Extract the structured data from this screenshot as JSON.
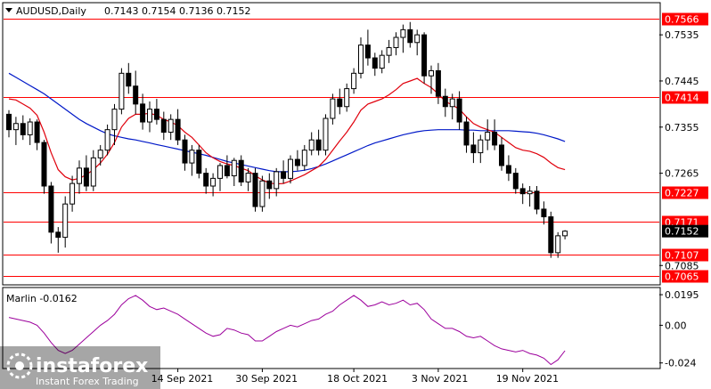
{
  "header": {
    "symbol": "AUDUSD,Daily",
    "ohlc": "0.7143 0.7154 0.7136 0.7152"
  },
  "indicator": {
    "label": "Marlin -0.0162"
  },
  "watermark": {
    "brand": "instaforex",
    "tagline": "Instant Forex Trading"
  },
  "colors": {
    "level_line": "#ff0000",
    "ma_fast": "#e0000c",
    "ma_slow": "#0018c8",
    "oscillator": "#9c009c",
    "candle": "#000000",
    "current_price_bg": "#000000"
  },
  "chart_data": {
    "type": "candlestick",
    "symbol": "AUDUSD",
    "timeframe": "Daily",
    "price_axis": {
      "ticks": [
        "0.7535",
        "0.7445",
        "0.7355",
        "0.7265",
        "0.7085"
      ],
      "range": [
        0.7049,
        0.7596
      ]
    },
    "levels": [
      {
        "value": 0.7566,
        "label": "0.7566"
      },
      {
        "value": 0.7414,
        "label": "0.7414"
      },
      {
        "value": 0.7227,
        "label": "0.7227"
      },
      {
        "value": 0.7171,
        "label": "0.7171"
      },
      {
        "value": 0.7107,
        "label": "0.7107"
      },
      {
        "value": 0.7065,
        "label": "0.7065"
      }
    ],
    "current_price": {
      "value": 0.7152,
      "label": "0.7152"
    },
    "date_labels": [
      {
        "label": "14 Sep 2021",
        "index": 24
      },
      {
        "label": "30 Sep 2021",
        "index": 36
      },
      {
        "label": "18 Oct 2021",
        "index": 49
      },
      {
        "label": "3 Nov 2021",
        "index": 61
      },
      {
        "label": "19 Nov 2021",
        "index": 73
      }
    ],
    "candles": [
      [
        0.738,
        0.7388,
        0.7335,
        0.735
      ],
      [
        0.735,
        0.7375,
        0.732,
        0.7362
      ],
      [
        0.7362,
        0.7378,
        0.733,
        0.734
      ],
      [
        0.734,
        0.7372,
        0.732,
        0.7365
      ],
      [
        0.7365,
        0.737,
        0.731,
        0.7325
      ],
      [
        0.7325,
        0.733,
        0.7225,
        0.724
      ],
      [
        0.724,
        0.7248,
        0.7128,
        0.715
      ],
      [
        0.715,
        0.716,
        0.711,
        0.714
      ],
      [
        0.714,
        0.722,
        0.712,
        0.7205
      ],
      [
        0.7205,
        0.726,
        0.719,
        0.7245
      ],
      [
        0.7245,
        0.729,
        0.7225,
        0.7275
      ],
      [
        0.7275,
        0.73,
        0.723,
        0.724
      ],
      [
        0.724,
        0.731,
        0.723,
        0.7295
      ],
      [
        0.7295,
        0.732,
        0.728,
        0.731
      ],
      [
        0.731,
        0.736,
        0.73,
        0.735
      ],
      [
        0.735,
        0.74,
        0.732,
        0.739
      ],
      [
        0.739,
        0.747,
        0.738,
        0.746
      ],
      [
        0.746,
        0.748,
        0.742,
        0.7435
      ],
      [
        0.7435,
        0.7465,
        0.738,
        0.74
      ],
      [
        0.74,
        0.742,
        0.735,
        0.7365
      ],
      [
        0.7365,
        0.7405,
        0.7345,
        0.739
      ],
      [
        0.739,
        0.741,
        0.736,
        0.737
      ],
      [
        0.737,
        0.7385,
        0.733,
        0.7345
      ],
      [
        0.7345,
        0.738,
        0.733,
        0.737
      ],
      [
        0.737,
        0.739,
        0.732,
        0.733
      ],
      [
        0.733,
        0.734,
        0.727,
        0.7285
      ],
      [
        0.7285,
        0.732,
        0.726,
        0.731
      ],
      [
        0.731,
        0.732,
        0.7255,
        0.7265
      ],
      [
        0.7265,
        0.7275,
        0.7225,
        0.724
      ],
      [
        0.724,
        0.7265,
        0.722,
        0.7255
      ],
      [
        0.7255,
        0.7285,
        0.723,
        0.728
      ],
      [
        0.728,
        0.73,
        0.7255,
        0.726
      ],
      [
        0.726,
        0.7295,
        0.724,
        0.729
      ],
      [
        0.729,
        0.73,
        0.724,
        0.7248
      ],
      [
        0.7248,
        0.7275,
        0.723,
        0.7265
      ],
      [
        0.7265,
        0.7275,
        0.719,
        0.72
      ],
      [
        0.72,
        0.726,
        0.719,
        0.725
      ],
      [
        0.725,
        0.7265,
        0.7215,
        0.7235
      ],
      [
        0.7235,
        0.7275,
        0.722,
        0.7268
      ],
      [
        0.7268,
        0.729,
        0.7245,
        0.7255
      ],
      [
        0.7255,
        0.73,
        0.7245,
        0.7292
      ],
      [
        0.7292,
        0.731,
        0.727,
        0.728
      ],
      [
        0.728,
        0.732,
        0.727,
        0.731
      ],
      [
        0.731,
        0.7345,
        0.73,
        0.733
      ],
      [
        0.733,
        0.735,
        0.73,
        0.731
      ],
      [
        0.731,
        0.738,
        0.73,
        0.7372
      ],
      [
        0.7372,
        0.742,
        0.736,
        0.741
      ],
      [
        0.741,
        0.743,
        0.738,
        0.7395
      ],
      [
        0.7395,
        0.744,
        0.7385,
        0.743
      ],
      [
        0.743,
        0.747,
        0.742,
        0.746
      ],
      [
        0.746,
        0.753,
        0.745,
        0.7515
      ],
      [
        0.7515,
        0.7545,
        0.7475,
        0.749
      ],
      [
        0.749,
        0.75,
        0.7455,
        0.747
      ],
      [
        0.747,
        0.7505,
        0.746,
        0.7495
      ],
      [
        0.7495,
        0.7525,
        0.748,
        0.751
      ],
      [
        0.751,
        0.754,
        0.7495,
        0.753
      ],
      [
        0.753,
        0.7555,
        0.75,
        0.7545
      ],
      [
        0.7545,
        0.756,
        0.751,
        0.752
      ],
      [
        0.752,
        0.7545,
        0.7495,
        0.7535
      ],
      [
        0.7535,
        0.754,
        0.744,
        0.7455
      ],
      [
        0.7455,
        0.7475,
        0.742,
        0.7465
      ],
      [
        0.7465,
        0.748,
        0.74,
        0.7415
      ],
      [
        0.7415,
        0.743,
        0.7375,
        0.7395
      ],
      [
        0.7395,
        0.742,
        0.737,
        0.741
      ],
      [
        0.741,
        0.7425,
        0.735,
        0.7365
      ],
      [
        0.7365,
        0.7375,
        0.7305,
        0.732
      ],
      [
        0.732,
        0.7345,
        0.7285,
        0.7305
      ],
      [
        0.7305,
        0.734,
        0.7285,
        0.733
      ],
      [
        0.733,
        0.737,
        0.731,
        0.7345
      ],
      [
        0.7345,
        0.737,
        0.731,
        0.732
      ],
      [
        0.732,
        0.7335,
        0.727,
        0.728
      ],
      [
        0.728,
        0.73,
        0.725,
        0.7265
      ],
      [
        0.7265,
        0.7275,
        0.7225,
        0.7235
      ],
      [
        0.7235,
        0.7245,
        0.7205,
        0.7225
      ],
      [
        0.7225,
        0.724,
        0.72,
        0.723
      ],
      [
        0.723,
        0.724,
        0.7185,
        0.7195
      ],
      [
        0.7195,
        0.721,
        0.7165,
        0.718
      ],
      [
        0.718,
        0.719,
        0.71,
        0.711
      ],
      [
        0.711,
        0.715,
        0.71,
        0.7143
      ],
      [
        0.7143,
        0.7154,
        0.7136,
        0.7152
      ]
    ],
    "ma_fast": [
      0.741,
      0.7408,
      0.74,
      0.7392,
      0.7378,
      0.7345,
      0.7305,
      0.7272,
      0.7258,
      0.7252,
      0.7255,
      0.7262,
      0.7272,
      0.7285,
      0.7302,
      0.7325,
      0.7355,
      0.7372,
      0.738,
      0.738,
      0.7382,
      0.7378,
      0.737,
      0.7365,
      0.7358,
      0.7345,
      0.7335,
      0.732,
      0.7305,
      0.7295,
      0.7288,
      0.7283,
      0.728,
      0.7275,
      0.727,
      0.726,
      0.7252,
      0.7246,
      0.7244,
      0.7245,
      0.725,
      0.7256,
      0.7262,
      0.727,
      0.7278,
      0.7292,
      0.731,
      0.7328,
      0.7345,
      0.7365,
      0.7388,
      0.74,
      0.7405,
      0.741,
      0.7418,
      0.7428,
      0.744,
      0.7445,
      0.745,
      0.744,
      0.7432,
      0.742,
      0.7405,
      0.7398,
      0.739,
      0.7375,
      0.7362,
      0.7355,
      0.735,
      0.7345,
      0.7335,
      0.7325,
      0.7315,
      0.731,
      0.7308,
      0.7303,
      0.7296,
      0.7285,
      0.7276,
      0.7272
    ],
    "ma_slow": [
      0.746,
      0.7452,
      0.7444,
      0.7436,
      0.7428,
      0.742,
      0.741,
      0.74,
      0.739,
      0.738,
      0.737,
      0.7362,
      0.7355,
      0.7348,
      0.7342,
      0.7338,
      0.7335,
      0.7332,
      0.733,
      0.7327,
      0.7324,
      0.7321,
      0.7318,
      0.7315,
      0.7312,
      0.7309,
      0.7306,
      0.7303,
      0.73,
      0.7296,
      0.7292,
      0.7288,
      0.7285,
      0.7282,
      0.7279,
      0.7276,
      0.7273,
      0.727,
      0.7268,
      0.7268,
      0.7268,
      0.7269,
      0.7271,
      0.7274,
      0.7278,
      0.7283,
      0.7289,
      0.7295,
      0.7301,
      0.7307,
      0.7313,
      0.7319,
      0.7324,
      0.7328,
      0.7332,
      0.7336,
      0.734,
      0.7343,
      0.7346,
      0.7348,
      0.7349,
      0.735,
      0.735,
      0.735,
      0.735,
      0.7349,
      0.7349,
      0.7348,
      0.7348,
      0.7348,
      0.7348,
      0.7348,
      0.7347,
      0.7346,
      0.7345,
      0.7343,
      0.734,
      0.7336,
      0.7332,
      0.7327
    ],
    "oscillator": {
      "name": "Marlin",
      "ticks": [
        "0.0195",
        "0.00",
        "-0.024"
      ],
      "range": [
        -0.027,
        0.0235
      ],
      "values": [
        0.005,
        0.004,
        0.003,
        0.002,
        0.0,
        -0.005,
        -0.011,
        -0.016,
        -0.018,
        -0.016,
        -0.012,
        -0.008,
        -0.004,
        0.0,
        0.003,
        0.007,
        0.013,
        0.017,
        0.019,
        0.016,
        0.012,
        0.01,
        0.011,
        0.009,
        0.007,
        0.004,
        0.001,
        -0.002,
        -0.005,
        -0.007,
        -0.006,
        -0.002,
        -0.003,
        -0.005,
        -0.006,
        -0.01,
        -0.01,
        -0.007,
        -0.004,
        -0.002,
        0.0,
        -0.001,
        0.001,
        0.003,
        0.004,
        0.007,
        0.009,
        0.013,
        0.016,
        0.019,
        0.016,
        0.012,
        0.013,
        0.015,
        0.013,
        0.014,
        0.016,
        0.013,
        0.014,
        0.01,
        0.004,
        0.001,
        -0.002,
        -0.002,
        -0.004,
        -0.007,
        -0.008,
        -0.007,
        -0.01,
        -0.013,
        -0.015,
        -0.016,
        -0.017,
        -0.016,
        -0.018,
        -0.019,
        -0.021,
        -0.025,
        -0.022,
        -0.0162
      ]
    }
  }
}
